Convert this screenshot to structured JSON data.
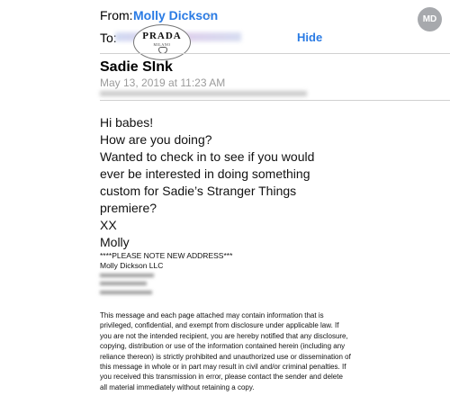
{
  "header": {
    "from_label": "From:",
    "from_name": "Molly Dickson",
    "chevron": "›",
    "avatar_initials": "MD",
    "to_label": "To:",
    "hide_label": "Hide"
  },
  "logo": {
    "brand": "PRADA",
    "city": "MILANO"
  },
  "message": {
    "subject": "Sadie SInk",
    "date": "May 13, 2019 at 11:23 AM",
    "body_lines": [
      "Hi babes!",
      "How are you doing?",
      "Wanted to check in to see if you would ever be interested in doing something custom for Sadie’s Stranger Things premiere?",
      "XX",
      "Molly"
    ]
  },
  "signature": {
    "notice": "****PLEASE NOTE NEW ADDRESS***",
    "company": "Molly Dickson LLC"
  },
  "disclaimer": "This message and each page attached may contain information that is privileged, confidential, and exempt from disclosure under applicable law. If you are not the intended recipient, you are hereby notified that any disclosure, copying, distribution or use of the information contained herein (including any reliance thereon) is strictly prohibited and unauthorized use or dissemination of this message in whole or in part may result in civil and/or criminal penalties.  If you received this transmission in error, please contact the sender and delete all material immediately without retaining a copy.",
  "colors": {
    "link_blue": "#2a7be4",
    "avatar_gray": "#a7a9ad",
    "meta_gray": "#9b9b9b"
  }
}
